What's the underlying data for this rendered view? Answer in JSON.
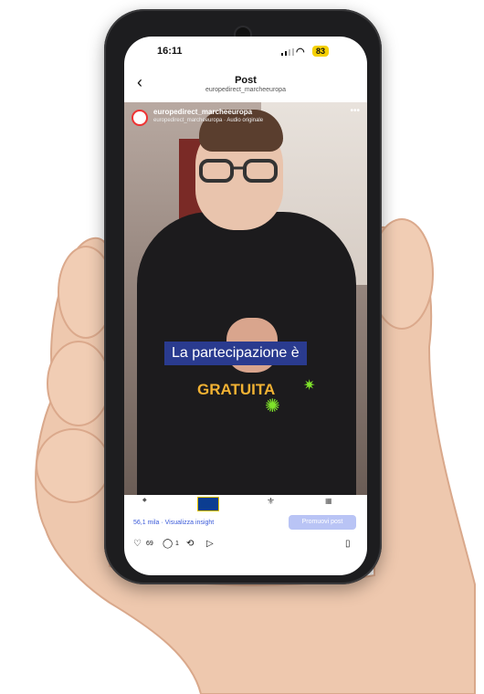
{
  "status": {
    "time": "16:11",
    "battery": "83"
  },
  "header": {
    "title": "Post",
    "subtitle": "europedirect_marcheeuropa"
  },
  "video": {
    "username": "europedirect_marcheeuropa",
    "audio": "europedirect_marcheeuropa · Audio originale",
    "caption_line1": "La partecipazione è",
    "caption_line2": "GRATUITA"
  },
  "insight": {
    "views": "56,1 mila · Visualizza insight",
    "promote": "Promuovi post"
  },
  "actions": {
    "likes": "69",
    "comments": "1"
  },
  "colors": {
    "caption_bg": "#2a3b8f",
    "caption_highlight": "#f2b233",
    "accent": "#3a5ad9"
  }
}
